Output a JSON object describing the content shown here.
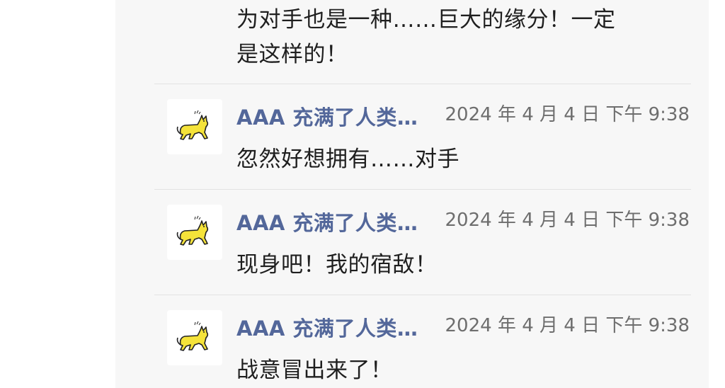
{
  "previous_message": {
    "line1": "为对手也是一种……巨大的缘分！一定",
    "line2": "是这样的！"
  },
  "messages": [
    {
      "sender": "AAA 充满了人类…",
      "time": "2024 年 4 月 4 日 下午 9:38",
      "text": "忽然好想拥有……对手"
    },
    {
      "sender": "AAA 充满了人类…",
      "time": "2024 年 4 月 4 日 下午 9:38",
      "text": "现身吧！我的宿敌！"
    },
    {
      "sender": "AAA 充满了人类…",
      "time": "2024 年 4 月 4 日 下午 9:38",
      "text": "战意冒出来了！"
    }
  ],
  "avatar_icon": "yellow-cat-icon",
  "colors": {
    "panel_bg": "#f7f7f7",
    "sender": "#53679a",
    "time": "#6e6e6e",
    "text": "#1f1f1f",
    "cat_yellow": "#f5e33a"
  }
}
